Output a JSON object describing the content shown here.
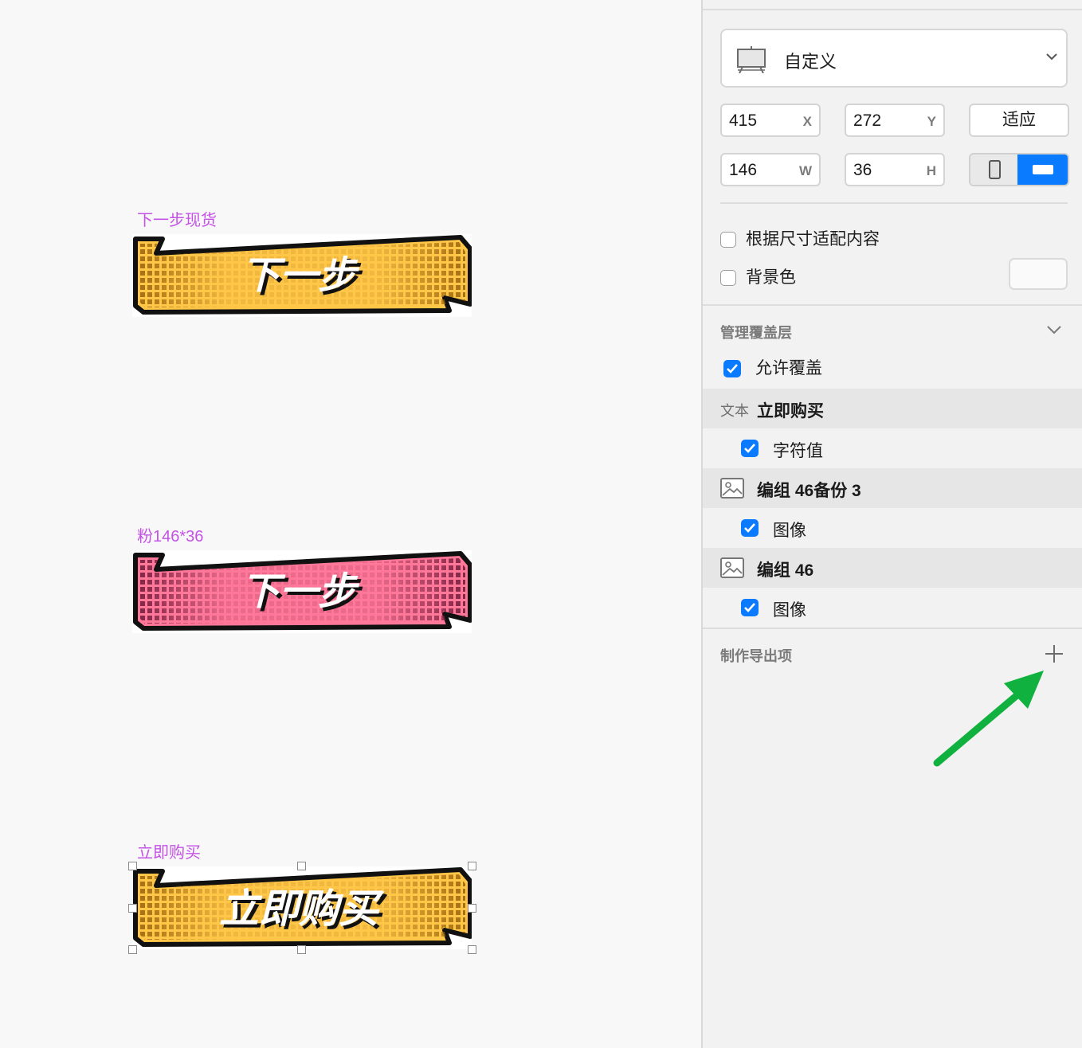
{
  "canvas": {
    "artboards": [
      {
        "label": "下一步现货",
        "button_text": "下一步",
        "fill": "#ffc648",
        "dots": "#a06a10"
      },
      {
        "label": "粉146*36",
        "button_text": "下一步",
        "fill": "#ff7799",
        "dots": "#8a2a4a"
      },
      {
        "label": "立即购买",
        "button_text": "立即购买",
        "fill": "#ffc648",
        "dots": "#a06a10",
        "selected": true
      }
    ]
  },
  "inspector": {
    "preset": {
      "label": "自定义",
      "icon": "artboard-icon"
    },
    "position": {
      "x": "415",
      "x_unit": "X",
      "y": "272",
      "y_unit": "Y"
    },
    "size": {
      "w": "146",
      "w_unit": "W",
      "h": "36",
      "h_unit": "H"
    },
    "fit_button": "适应",
    "orientation": {
      "options": [
        "portrait",
        "landscape"
      ],
      "selected": "landscape"
    },
    "resize_content": {
      "label": "根据尺寸适配内容",
      "checked": false
    },
    "background": {
      "label": "背景色",
      "checked": false
    },
    "overrides": {
      "title": "管理覆盖层",
      "allow": {
        "label": "允许覆盖",
        "checked": true
      },
      "layers": [
        {
          "type_tag": "文本",
          "name": "立即购买",
          "child": "字符值",
          "child_checked": true
        },
        {
          "type_tag": "image-icon",
          "name": "编组 46备份 3",
          "child": "图像",
          "child_checked": true
        },
        {
          "type_tag": "image-icon",
          "name": "编组 46",
          "child": "图像",
          "child_checked": true
        }
      ]
    },
    "export": {
      "title": "制作导出项",
      "add_icon": "plus-icon"
    }
  },
  "colors": {
    "accent": "#0a7aff",
    "label": "#c452e6",
    "arrow": "#10b13e"
  }
}
